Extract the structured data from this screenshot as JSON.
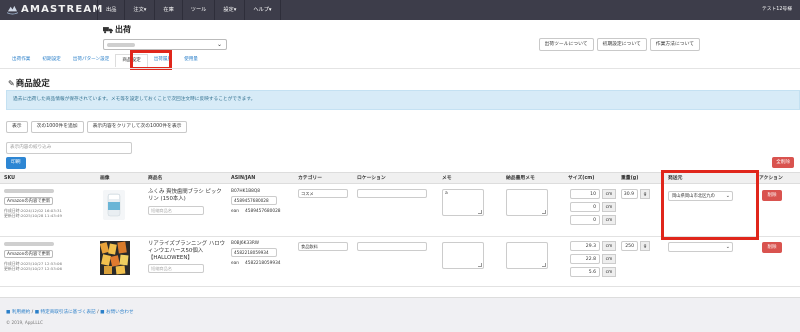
{
  "app": {
    "brand": "AMASTREAM",
    "user": "テスト12号様"
  },
  "nav": {
    "items": [
      "出品",
      "注文▾",
      "在庫",
      "ツール",
      "設定▾",
      "ヘルプ▾"
    ]
  },
  "page": {
    "title": "出荷",
    "info_buttons": [
      "出荷ツールについて",
      "初期設定について",
      "作業方法について"
    ]
  },
  "tabs": [
    "出荷作業",
    "初期設定",
    "出荷パターン設定",
    "商品設定",
    "出荷履歴",
    "使用量"
  ],
  "section": {
    "title": "商品設定",
    "info": "過去に出荷した商品情報が保存されています。メモ等を設定しておくことで次回注文時に反映することができます。"
  },
  "actions": {
    "show": "表示",
    "add_next": "次の1000件を追加",
    "clear_next": "表示内容をクリアして次の1000件を表示",
    "filter_placeholder": "表示内容の絞り込み",
    "print": "印刷",
    "delete_all": "全削除"
  },
  "table": {
    "headers": [
      "SKU",
      "画像",
      "商品名",
      "ASIN/JAN",
      "カテゴリー",
      "ロケーション",
      "メモ",
      "納品書用メモ",
      "サイズ(cm)",
      "重量(g)",
      "発送元",
      "アクション"
    ],
    "name_placeholder": "短縮商品名",
    "amazon_btn": "Amazonの内容で更新",
    "delete_btn": "削除",
    "rows": [
      {
        "created": "作成日時:2024/12/02 16:03:31",
        "updated": "更新日時:2025/10/28 11:43:49",
        "name": "ふくみ 爽快歯間ブラシ ピックリン (150本入)",
        "asin": "B07HK1B8Q8",
        "jan": "4589457680028",
        "ean_label": "ean",
        "ean": "4589457680028",
        "category": "コスメ",
        "location": "",
        "memo": "a",
        "slip_memo": "",
        "sizes": [
          "10",
          "0",
          "0"
        ],
        "unit": "cm",
        "weight": "30.9",
        "weight_unit": "g",
        "origin": "岡山県岡山市北区九の"
      },
      {
        "created": "作成日時:2025/10/27 12:53:06",
        "updated": "更新日時:2025/10/27 12:53:06",
        "name": "リアライズプランニング ハロウィンウエハース50個入【HALLOWEEN】",
        "asin": "B0BJ6K33RW",
        "jan": "4582218059934",
        "ean_label": "ean",
        "ean": "4582218059934",
        "category": "食品飲料",
        "location": "",
        "memo": "",
        "slip_memo": "",
        "sizes": [
          "29.3",
          "22.8",
          "5.6"
        ],
        "unit": "cm",
        "weight": "250",
        "weight_unit": "g",
        "origin": ""
      }
    ]
  },
  "footer": {
    "link1": "利用規約",
    "link2": "特定商取引法に基づく表記",
    "link3": "お問い合わせ",
    "copyright": "© 2019, AppLLLC"
  },
  "colors": {
    "nav_bg": "#3d3d4a",
    "link": "#2a7fc9",
    "primary": "#2d86d3",
    "danger": "#d9534f",
    "highlight": "#e0261b",
    "info_bg": "#d7ebf7"
  }
}
